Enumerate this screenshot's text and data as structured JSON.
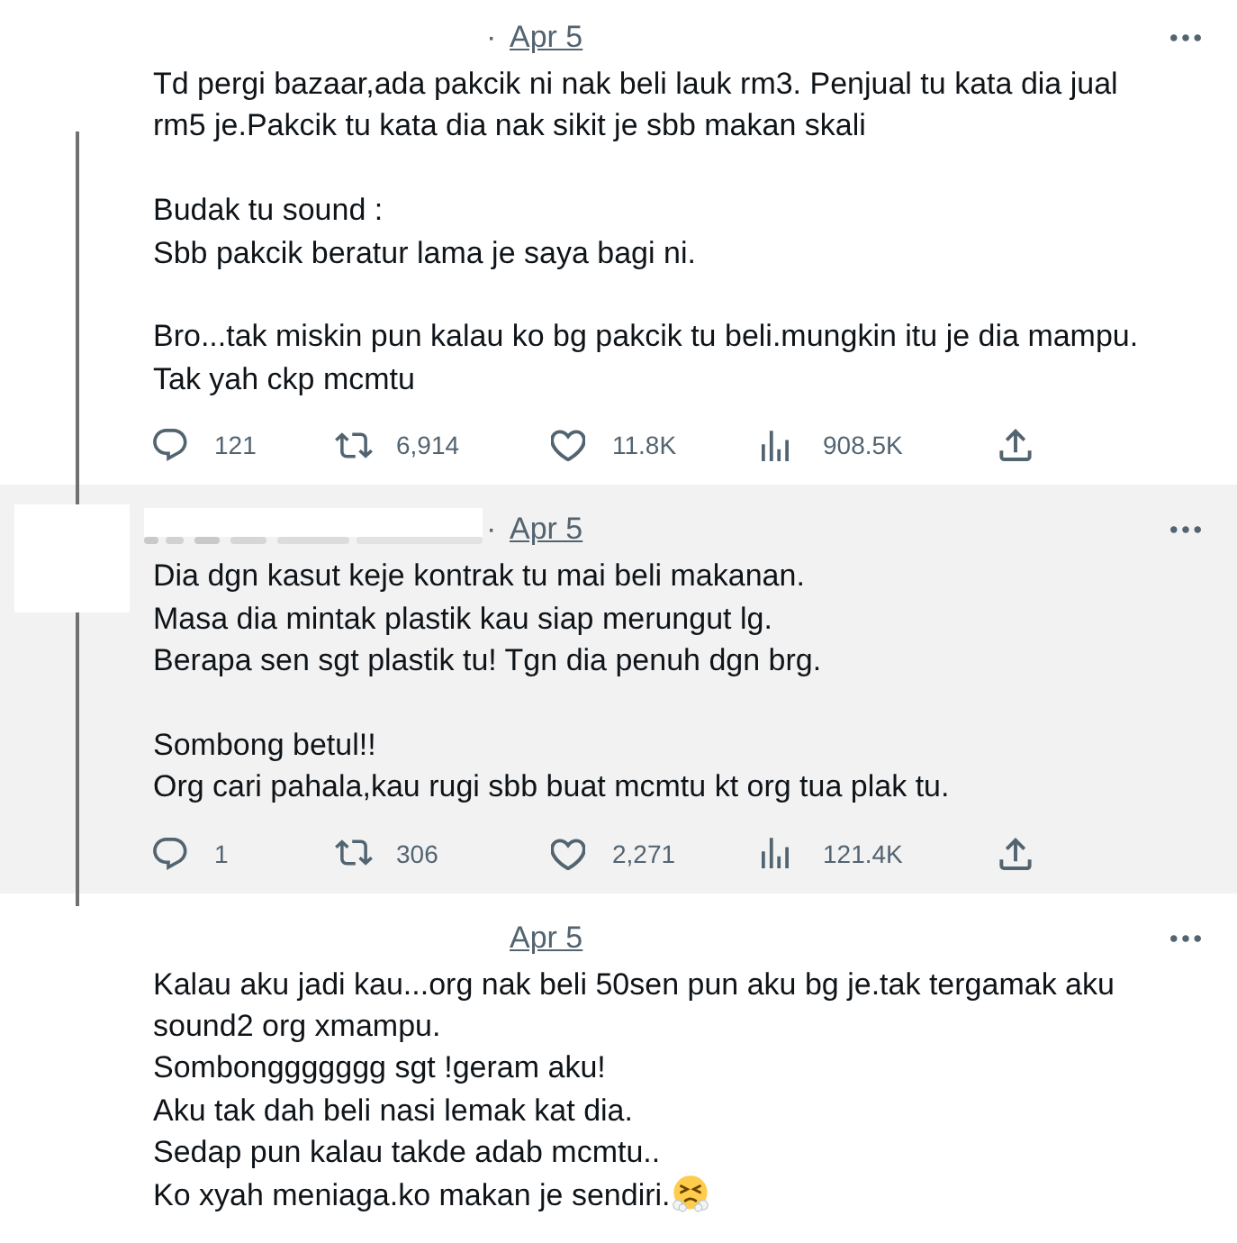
{
  "tweets": [
    {
      "hovered": false,
      "author_blurred": false,
      "separator": "·",
      "date": "Apr 5",
      "paragraphs": [
        "Td pergi bazaar,ada pakcik ni nak beli lauk rm3. Penjual tu kata dia jual rm5 je.Pakcik tu kata dia nak sikit je sbb makan skali",
        "Budak tu sound :\nSbb pakcik beratur lama je saya bagi ni.",
        "Bro...tak miskin pun kalau ko bg pakcik tu beli.mungkin itu je dia mampu.\nTak yah ckp mcmtu"
      ],
      "trailing_emoji": false,
      "actions": [
        {
          "kind": "reply",
          "count": "121"
        },
        {
          "kind": "retweet",
          "count": "6,914"
        },
        {
          "kind": "like",
          "count": "11.8K"
        },
        {
          "kind": "views",
          "count": "908.5K"
        },
        {
          "kind": "share"
        }
      ]
    },
    {
      "hovered": true,
      "author_blurred": true,
      "separator": "·",
      "date": "Apr 5",
      "paragraphs": [
        "Dia dgn kasut keje kontrak tu mai beli makanan.\nMasa dia mintak plastik kau siap merungut lg.\nBerapa sen sgt plastik tu! Tgn dia penuh dgn brg.",
        "Sombong betul!!\nOrg cari pahala,kau rugi sbb buat mcmtu kt org tua plak tu."
      ],
      "trailing_emoji": false,
      "actions": [
        {
          "kind": "reply",
          "count": "1"
        },
        {
          "kind": "retweet",
          "count": "306"
        },
        {
          "kind": "like",
          "count": "2,271"
        },
        {
          "kind": "views",
          "count": "121.4K"
        },
        {
          "kind": "share"
        }
      ]
    },
    {
      "hovered": false,
      "author_blurred": false,
      "date": "Apr 5",
      "paragraphs": [
        "Kalau aku jadi kau...org nak beli 50sen pun aku bg je.tak tergamak aku sound2 org xmampu.\nSombonggggggg sgt !geram aku!\nAku tak dah beli nasi lemak kat dia.\nSedap pun kalau takde adab mcmtu..\nKo xyah meniaga.ko makan je sendiri."
      ],
      "trailing_emoji": true
    }
  ]
}
